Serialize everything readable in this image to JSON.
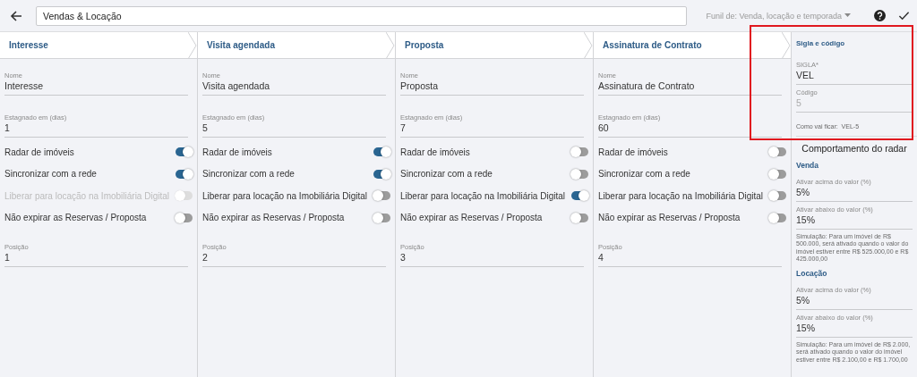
{
  "top_bar": {
    "title_value": "Vendas & Locação",
    "funnel_selector": "Funil de: Venda, locação e temporada"
  },
  "stages": [
    {
      "tab": "Interesse",
      "fields": [
        {
          "label": "Nome",
          "value": "Interesse"
        },
        {
          "label": "Estagnado em (dias)",
          "value": "1"
        }
      ],
      "toggles": [
        {
          "label": "Radar de imóveis",
          "on": true,
          "disabled": false
        },
        {
          "label": "Sincronizar com a rede",
          "on": true,
          "disabled": false
        },
        {
          "label": "Liberar para locação na Imobiliária Digital",
          "on": false,
          "disabled": true
        },
        {
          "label": "Não expirar as Reservas / Proposta",
          "on": false,
          "disabled": false
        }
      ],
      "position": {
        "label": "Posição",
        "value": "1"
      }
    },
    {
      "tab": "Visita agendada",
      "fields": [
        {
          "label": "Nome",
          "value": "Visita agendada"
        },
        {
          "label": "Estagnado em (dias)",
          "value": "5"
        }
      ],
      "toggles": [
        {
          "label": "Radar de imóveis",
          "on": true,
          "disabled": false
        },
        {
          "label": "Sincronizar com a rede",
          "on": true,
          "disabled": false
        },
        {
          "label": "Liberar para locação na Imobiliária Digital",
          "on": false,
          "disabled": false
        },
        {
          "label": "Não expirar as Reservas / Proposta",
          "on": false,
          "disabled": false
        }
      ],
      "position": {
        "label": "Posição",
        "value": "2"
      }
    },
    {
      "tab": "Proposta",
      "fields": [
        {
          "label": "Nome",
          "value": "Proposta"
        },
        {
          "label": "Estagnado em (dias)",
          "value": "7"
        }
      ],
      "toggles": [
        {
          "label": "Radar de imóveis",
          "on": false,
          "disabled": false
        },
        {
          "label": "Sincronizar com a rede",
          "on": false,
          "disabled": false
        },
        {
          "label": "Liberar para locação na Imobiliária Digital",
          "on": true,
          "disabled": false
        },
        {
          "label": "Não expirar as Reservas / Proposta",
          "on": false,
          "disabled": false
        }
      ],
      "position": {
        "label": "Posição",
        "value": "3"
      }
    },
    {
      "tab": "Assinatura de Contrato",
      "fields": [
        {
          "label": "Nome",
          "value": "Assinatura de Contrato"
        },
        {
          "label": "Estagnado em (dias)",
          "value": "60"
        }
      ],
      "toggles": [
        {
          "label": "Radar de imóveis",
          "on": false,
          "disabled": false
        },
        {
          "label": "Sincronizar com a rede",
          "on": false,
          "disabled": false
        },
        {
          "label": "Liberar para locação na Imobiliária Digital",
          "on": false,
          "disabled": false
        },
        {
          "label": "Não expirar as Reservas / Proposta",
          "on": false,
          "disabled": false
        }
      ],
      "position": {
        "label": "Posição",
        "value": "4"
      }
    }
  ],
  "side_panel": {
    "title": "Sigla e código",
    "highlighted": true,
    "sigla": {
      "label": "SIGLA*",
      "value": "VEL",
      "disabled": false
    },
    "codigo": {
      "label": "Código",
      "value": "5",
      "disabled": true
    },
    "preview": "Como vai ficar:  VEL-5",
    "radar": {
      "title": "Comportamento do radar",
      "groups": [
        {
          "title": "Venda",
          "fields": [
            {
              "label": "Ativar acima do valor (%)",
              "value": "5%"
            },
            {
              "label": "Ativar abaixo do valor (%)",
              "value": "15%"
            }
          ],
          "simulation": "Simulação: Para um imóvel de R$ 500.000, será ativado quando o valor do imóvel estiver entre R$ 525.000,00 e R$ 425.000,00"
        },
        {
          "title": "Locação",
          "fields": [
            {
              "label": "Ativar acima do valor (%)",
              "value": "5%"
            },
            {
              "label": "Ativar abaixo do valor (%)",
              "value": "15%"
            }
          ],
          "simulation": "Simulação: Para um imóvel de R$ 2.000, será ativado quando o valor do imóvel estiver entre R$ 2.100,00 e R$ 1.700,00"
        }
      ]
    }
  }
}
